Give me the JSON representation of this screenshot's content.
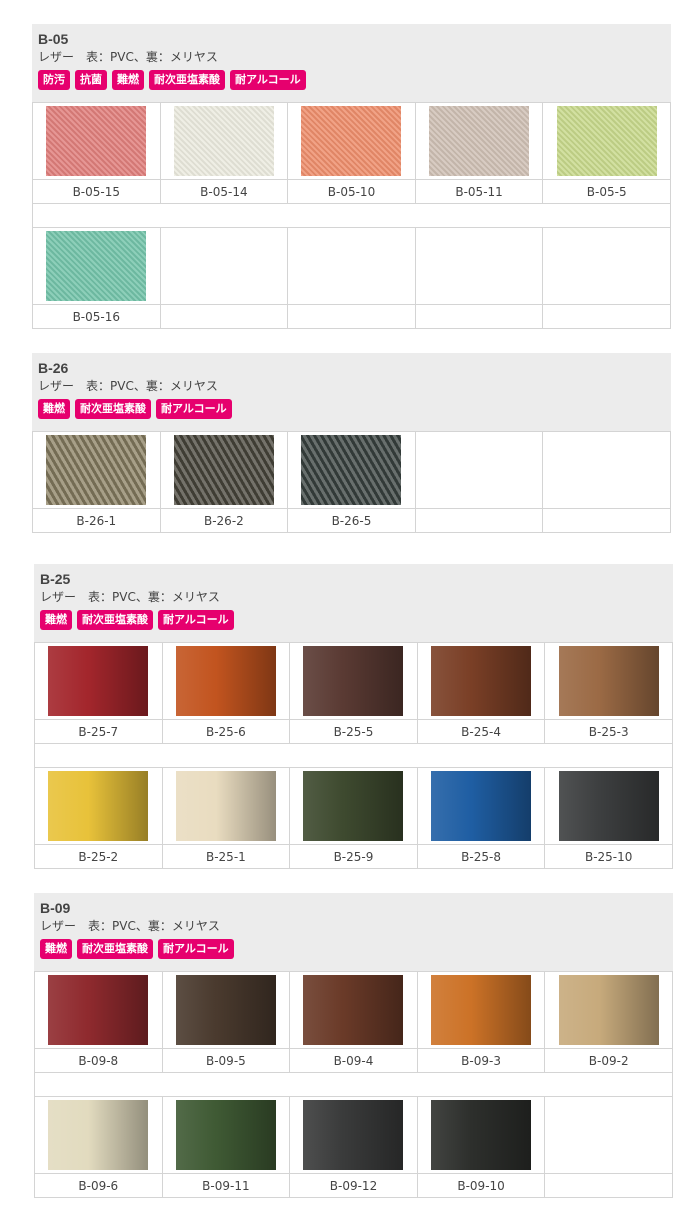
{
  "sections": [
    {
      "id": "b05",
      "title": "B-05",
      "desc": "レザー　表：PVC、裏：メリヤス",
      "badges": [
        "防汚",
        "抗菌",
        "難燃",
        "耐次亜塩素酸",
        "耐アルコール"
      ],
      "texture": "weave",
      "rows": [
        [
          {
            "code": "B-05-15",
            "color": "#e07f7c"
          },
          {
            "code": "B-05-14",
            "color": "#ecebdf"
          },
          {
            "code": "B-05-10",
            "color": "#ee8e6c"
          },
          {
            "code": "B-05-11",
            "color": "#cfc0b4"
          },
          {
            "code": "B-05-5",
            "color": "#c8d98c"
          }
        ],
        [
          {
            "code": "B-05-16",
            "color": "#74c4aa"
          }
        ]
      ]
    },
    {
      "id": "b26",
      "title": "B-26",
      "desc": "レザー　表：PVC、裏：メリヤス",
      "badges": [
        "難燃",
        "耐次亜塩素酸",
        "耐アルコール"
      ],
      "texture": "herring",
      "rows": [
        [
          {
            "code": "B-26-1",
            "color": "#8e8466"
          },
          {
            "code": "B-26-2",
            "color": "#4d4a40"
          },
          {
            "code": "B-26-5",
            "color": "#3d4744"
          }
        ]
      ]
    },
    {
      "id": "b25",
      "title": "B-25",
      "desc": "レザー　表：PVC、裏：メリヤス",
      "badges": [
        "難燃",
        "耐次亜塩素酸",
        "耐アルコール"
      ],
      "texture": "leather",
      "rows": [
        [
          {
            "code": "B-25-7",
            "color": "#a3262c"
          },
          {
            "code": "B-25-6",
            "color": "#c2541f"
          },
          {
            "code": "B-25-5",
            "color": "#5a3a33"
          },
          {
            "code": "B-25-4",
            "color": "#7a3f26"
          },
          {
            "code": "B-25-3",
            "color": "#9b6a45"
          }
        ],
        [
          {
            "code": "B-25-2",
            "color": "#e8c23a"
          },
          {
            "code": "B-25-1",
            "color": "#e9dcc0"
          },
          {
            "code": "B-25-9",
            "color": "#3e4a2f"
          },
          {
            "code": "B-25-8",
            "color": "#1f5ea3"
          },
          {
            "code": "B-25-10",
            "color": "#3d3f40"
          }
        ]
      ]
    },
    {
      "id": "b09",
      "title": "B-09",
      "desc": "レザー　表：PVC、裏：メリヤス",
      "badges": [
        "難燃",
        "耐次亜塩素酸",
        "耐アルコール"
      ],
      "texture": "leather",
      "rows": [
        [
          {
            "code": "B-09-8",
            "color": "#8f2a2e"
          },
          {
            "code": "B-09-5",
            "color": "#4a3a2e"
          },
          {
            "code": "B-09-4",
            "color": "#6a3a28"
          },
          {
            "code": "B-09-3",
            "color": "#cc7227"
          },
          {
            "code": "B-09-2",
            "color": "#c7aa7c"
          }
        ],
        [
          {
            "code": "B-09-6",
            "color": "#e2dbbf"
          },
          {
            "code": "B-09-11",
            "color": "#3f5a34"
          },
          {
            "code": "B-09-12",
            "color": "#3a3b3b"
          },
          {
            "code": "B-09-10",
            "color": "#2d2f2c"
          }
        ]
      ]
    }
  ]
}
